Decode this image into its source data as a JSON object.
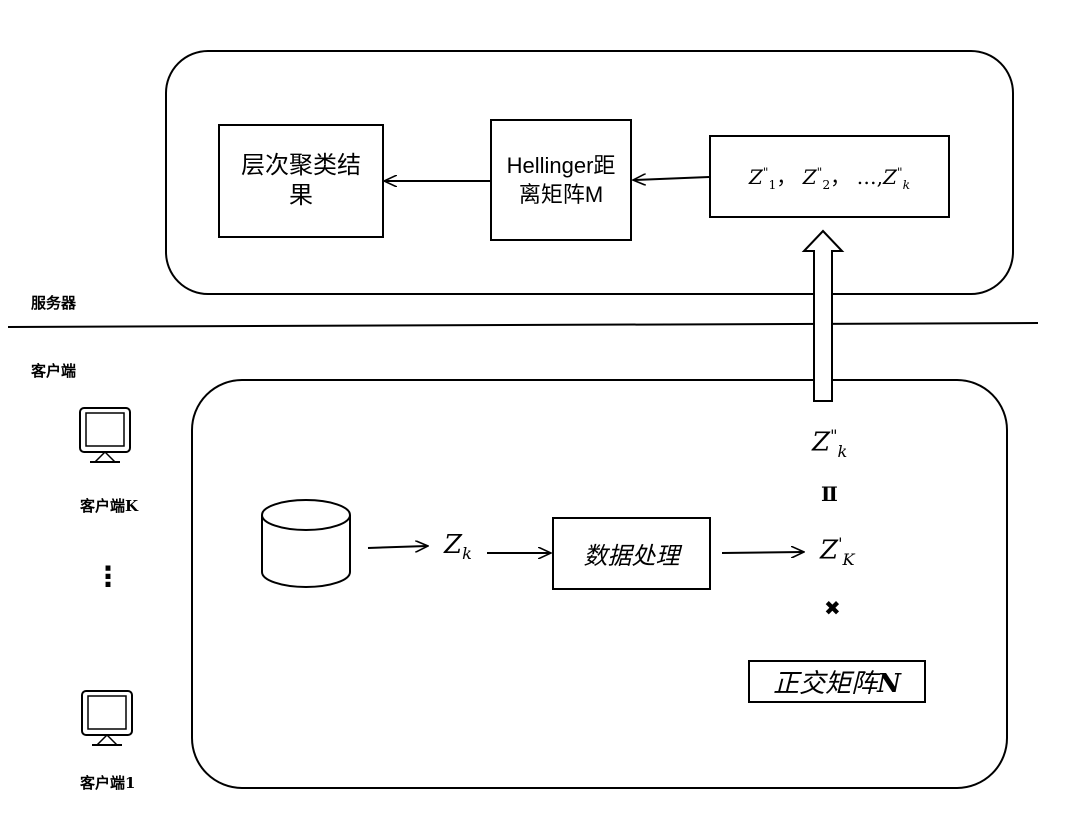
{
  "server": {
    "label": "服务器",
    "cluster_result": "层次聚类结果",
    "hellinger_matrix": "Hellinger距离矩阵M",
    "upload_set": {
      "z1": "Z",
      "z1_sub": "1",
      "z1_sup": "\"",
      "sep": "，",
      "z2": "Z",
      "z2_sub": "2",
      "z2_sup": "\"",
      "ellipsis": "…,",
      "zk": "Z",
      "zk_sub": "k",
      "zk_sup": "\""
    }
  },
  "client": {
    "label": "客户端",
    "client_k": "客户端K",
    "ellipsis": "⋮",
    "client_1": "客户端1",
    "zk_raw": {
      "base": "Z",
      "sub": "k"
    },
    "data_processing": "数据处理",
    "zk_prime": {
      "base": "Z",
      "sub": "K",
      "sup": "'"
    },
    "operator_symbol": "✖",
    "orthogonal_matrix": "正交矩阵",
    "orthogonal_matrix_letter": "N",
    "zk_double": {
      "base": "Z",
      "sub": "k",
      "sup": "\""
    },
    "equals_symbol": "Ⅱ"
  },
  "colors": {
    "stroke": "#000000",
    "background": "#ffffff"
  }
}
